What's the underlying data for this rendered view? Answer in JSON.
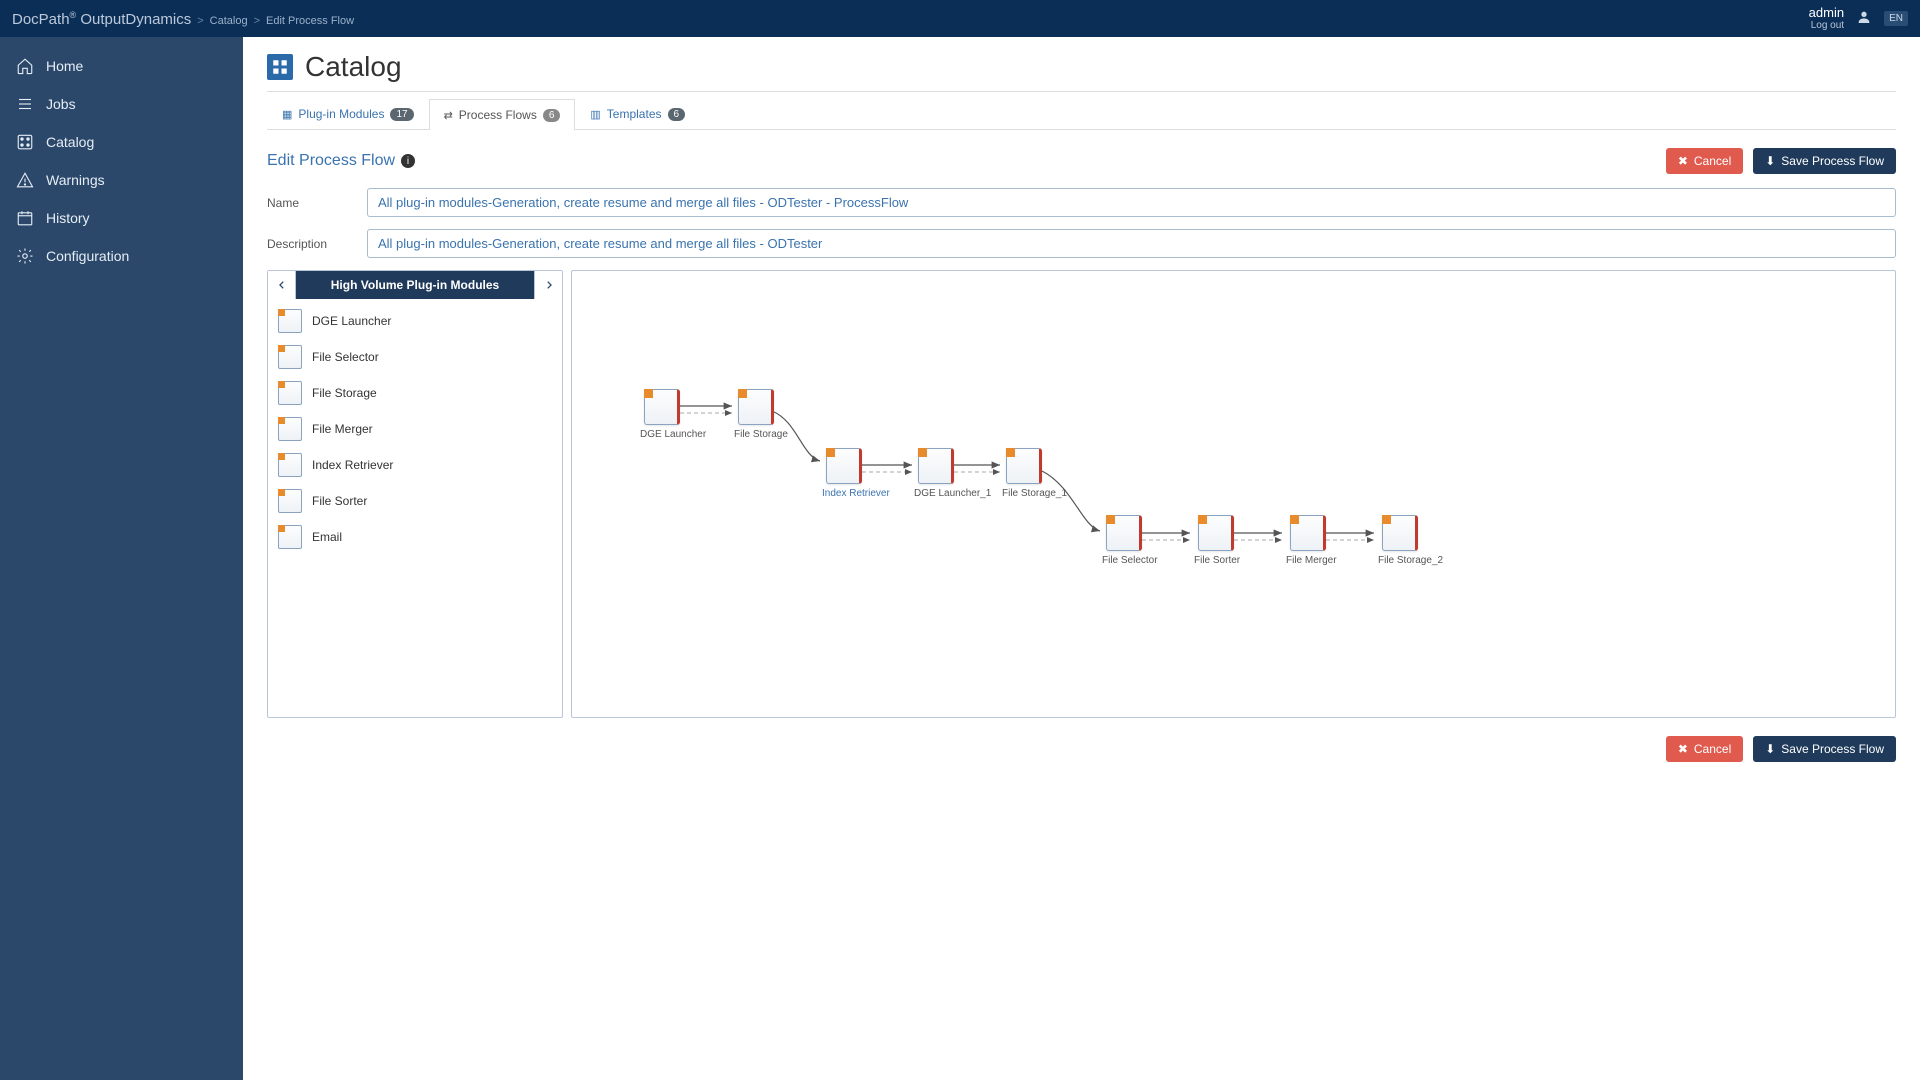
{
  "brand": {
    "name1": "DocPath",
    "name2": "OutputDynamics",
    "reg": "®"
  },
  "breadcrumbs": {
    "catalog": "Catalog",
    "edit": "Edit Process Flow",
    "sep": ">"
  },
  "header": {
    "user": "admin",
    "logout": "Log out",
    "lang": "EN"
  },
  "sidebar": {
    "items": [
      {
        "label": "Home"
      },
      {
        "label": "Jobs"
      },
      {
        "label": "Catalog"
      },
      {
        "label": "Warnings"
      },
      {
        "label": "History"
      },
      {
        "label": "Configuration"
      }
    ]
  },
  "page": {
    "title": "Catalog"
  },
  "tabs": {
    "plugin": {
      "label": "Plug-in Modules",
      "count": "17"
    },
    "flows": {
      "label": "Process Flows",
      "count": "6"
    },
    "templates": {
      "label": "Templates",
      "count": "6"
    }
  },
  "section": {
    "title": "Edit Process Flow"
  },
  "buttons": {
    "cancel": "Cancel",
    "save": "Save Process Flow"
  },
  "form": {
    "name_label": "Name",
    "name_value": "All plug-in modules-Generation, create resume and merge all files - ODTester - ProcessFlow",
    "desc_label": "Description",
    "desc_value": "All plug-in modules-Generation, create resume and merge all files - ODTester"
  },
  "palette": {
    "title": "High Volume Plug-in Modules",
    "items": [
      {
        "label": "DGE Launcher"
      },
      {
        "label": "File Selector"
      },
      {
        "label": "File Storage"
      },
      {
        "label": "File Merger"
      },
      {
        "label": "Index Retriever"
      },
      {
        "label": "File Sorter"
      },
      {
        "label": "Email"
      }
    ]
  },
  "nodes": {
    "n0": "DGE Launcher",
    "n1": "File Storage",
    "n2": "Index Retriever",
    "n3": "DGE Launcher_1",
    "n4": "File Storage_1",
    "n5": "File Selector",
    "n6": "File Sorter",
    "n7": "File Merger",
    "n8": "File Storage_2"
  }
}
